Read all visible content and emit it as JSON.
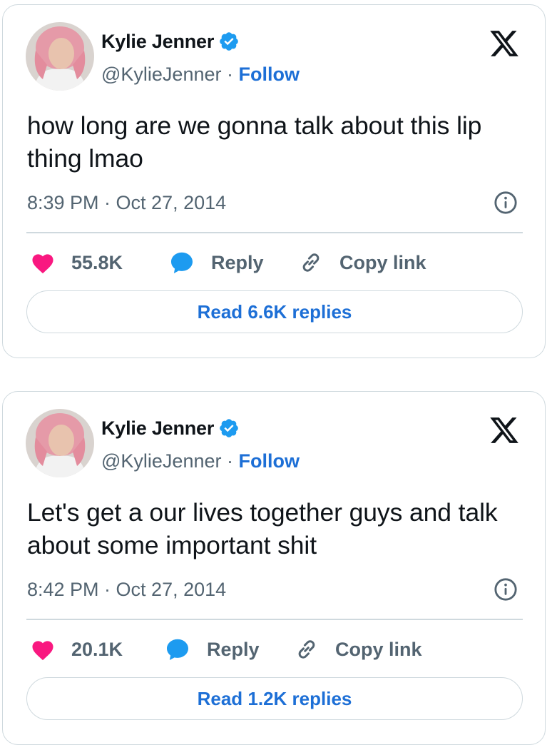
{
  "colors": {
    "link_blue": "#1d6fd6",
    "verified_blue": "#1d9bf0",
    "like_pink": "#f91880",
    "muted_gray": "#536471",
    "border": "#cfd9de"
  },
  "icons": [
    "verified-badge-icon",
    "x-logo-icon",
    "info-icon",
    "heart-icon",
    "reply-bubble-icon",
    "link-icon"
  ],
  "tweets": [
    {
      "author_name": "Kylie Jenner",
      "handle": "@KylieJenner",
      "separator": " · ",
      "follow_label": "Follow",
      "text": "how long are we gonna talk about this lip thing lmao",
      "timestamp": "8:39 PM · Oct 27, 2014",
      "likes": "55.8K",
      "reply_label": "Reply",
      "copy_label": "Copy link",
      "read_replies_label": "Read 6.6K replies"
    },
    {
      "author_name": "Kylie Jenner",
      "handle": "@KylieJenner",
      "separator": " · ",
      "follow_label": "Follow",
      "text": "Let's get a our lives together guys and talk about some important shit",
      "timestamp": "8:42 PM · Oct 27, 2014",
      "likes": "20.1K",
      "reply_label": "Reply",
      "copy_label": "Copy link",
      "read_replies_label": "Read 1.2K replies"
    }
  ]
}
